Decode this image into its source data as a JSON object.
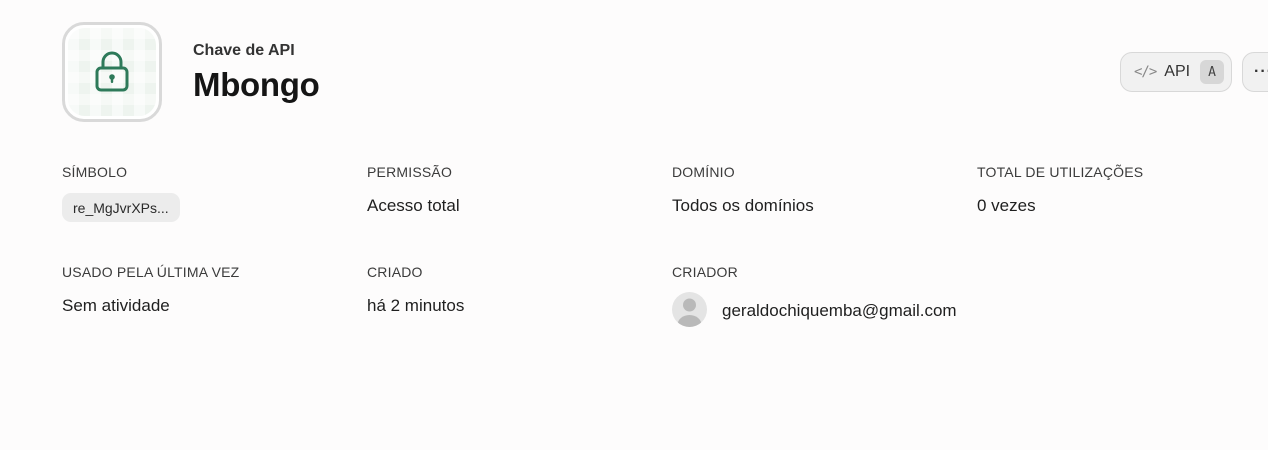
{
  "header": {
    "subtitle": "Chave de API",
    "title": "Mbongo",
    "icon": "lock-icon",
    "accent": "#2e7a5a"
  },
  "actions": {
    "api_label": "API",
    "api_shortcut": "A",
    "more_label": "···"
  },
  "details": {
    "token": {
      "label": "SÍMBOLO",
      "value": "re_MgJvrXPs..."
    },
    "permission": {
      "label": "PERMISSÃO",
      "value": "Acesso total"
    },
    "domain": {
      "label": "DOMÍNIO",
      "value": "Todos os domínios"
    },
    "usage": {
      "label": "TOTAL DE UTILIZAÇÕES",
      "value": "0 vezes"
    },
    "last_used": {
      "label": "USADO PELA ÚLTIMA VEZ",
      "value": "Sem atividade"
    },
    "created": {
      "label": "CRIADO",
      "value": "há 2 minutos"
    },
    "creator": {
      "label": "CRIADOR",
      "value": "geraldochiquemba@gmail.com"
    }
  }
}
